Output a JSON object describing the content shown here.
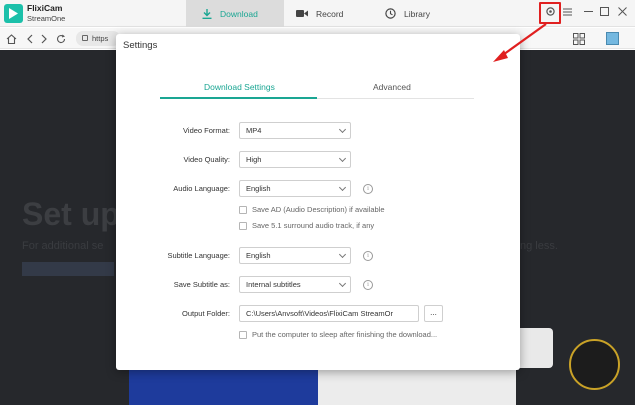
{
  "app": {
    "name": "FlixiCam",
    "subtitle": "StreamOne"
  },
  "nav": {
    "download": "Download",
    "record": "Record",
    "library": "Library"
  },
  "browser": {
    "url": "https"
  },
  "background": {
    "headline": "Set up",
    "line_left": "For additional se",
    "line_right": "ng less."
  },
  "settings": {
    "title": "Settings",
    "tabs": {
      "download_settings": "Download Settings",
      "advanced": "Advanced"
    },
    "video_format": {
      "label": "Video Format:",
      "value": "MP4"
    },
    "video_quality": {
      "label": "Video Quality:",
      "value": "High"
    },
    "audio_language": {
      "label": "Audio Language:",
      "value": "English"
    },
    "save_ad": "Save AD (Audio Description) if available",
    "save_51": "Save 5.1 surround audio track, if any",
    "subtitle_language": {
      "label": "Subtitle Language:",
      "value": "English"
    },
    "save_subtitle": {
      "label": "Save Subtitle as:",
      "value": "Internal subtitles"
    },
    "output_folder": {
      "label": "Output Folder:",
      "value": "C:\\Users\\Anvsoft\\Videos\\FlixiCam StreamOr",
      "browse": "..."
    },
    "sleep": "Put the computer to sleep after finishing the download..."
  },
  "colors": {
    "accent": "#1aa693",
    "highlight": "#e02020"
  }
}
